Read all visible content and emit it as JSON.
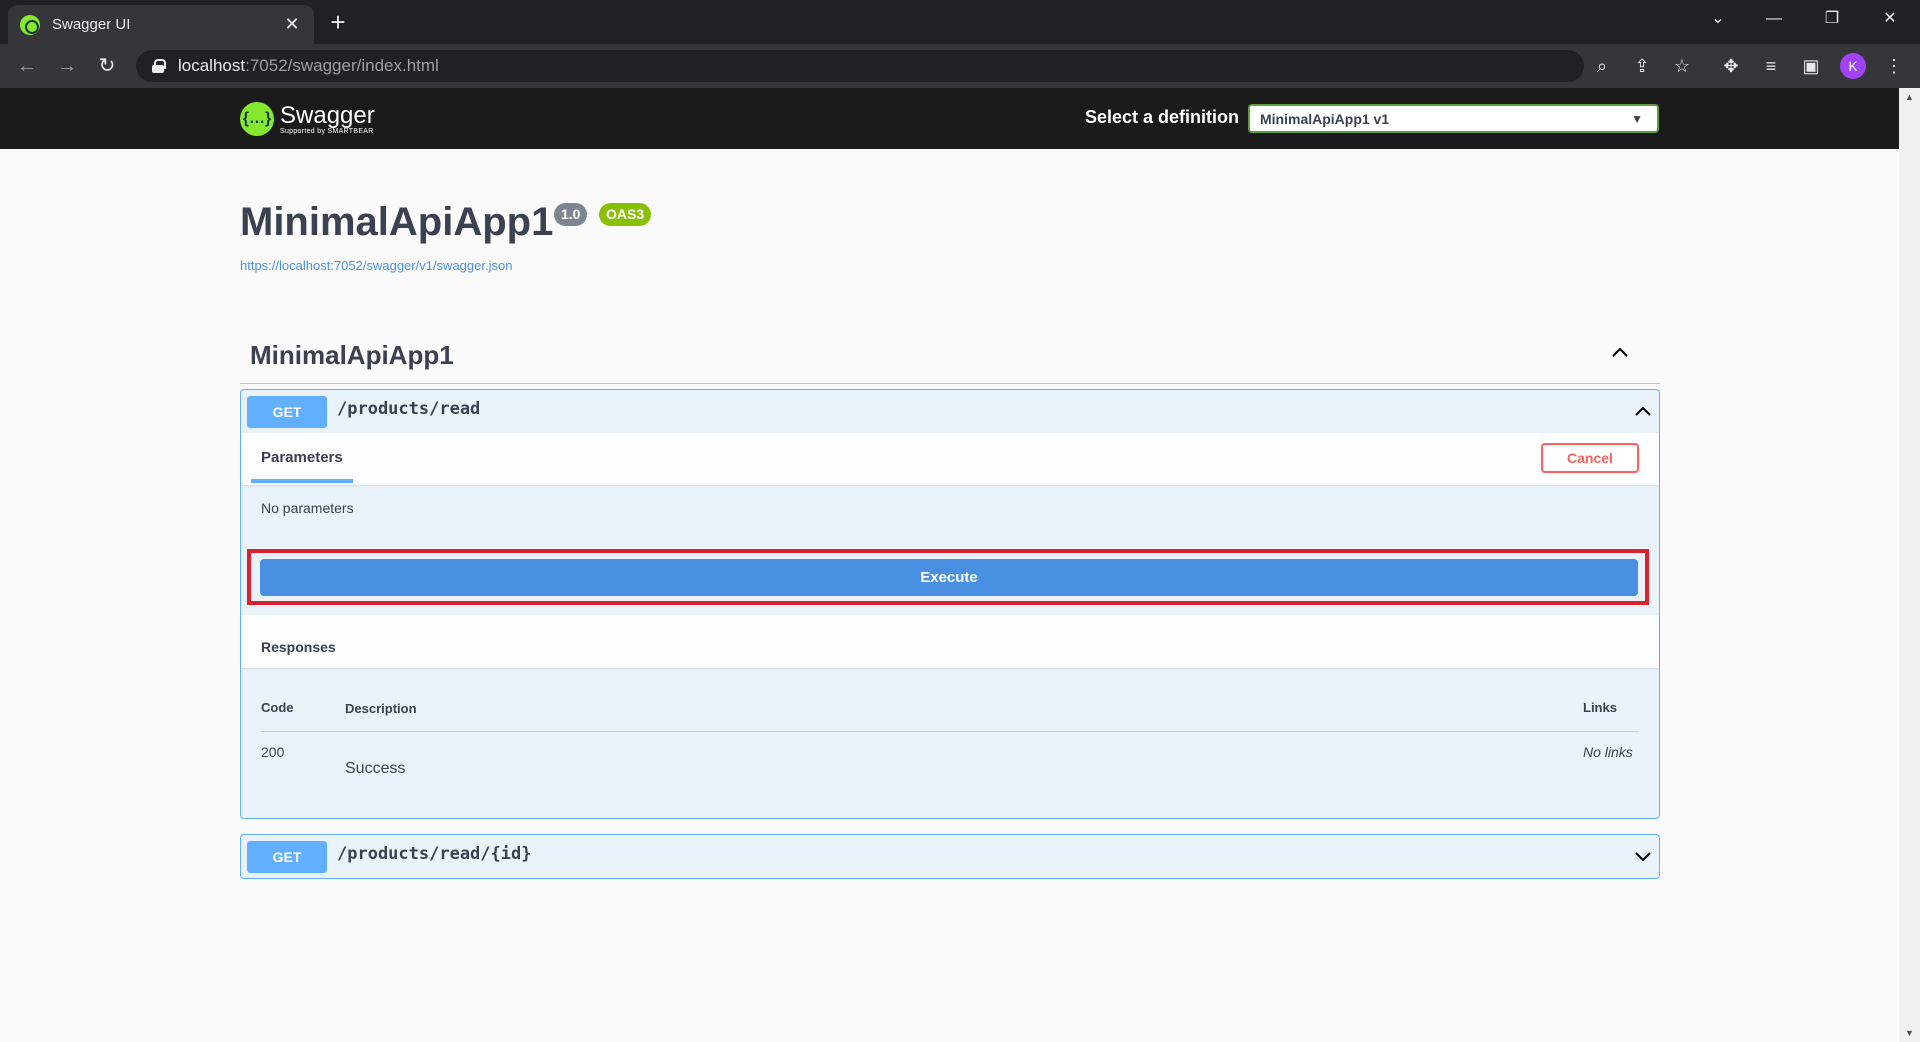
{
  "browser": {
    "tab_title": "Swagger UI",
    "url_host": "localhost",
    "url_path": ":7052/swagger/index.html",
    "profile_initial": "K"
  },
  "swagger": {
    "logo_text": "Swagger",
    "logo_subtext": "Supported by SMARTBEAR",
    "definition_label": "Select a definition",
    "definition_selected": "MinimalApiApp1 v1"
  },
  "info": {
    "title": "MinimalApiApp1",
    "version": "1.0",
    "oas": "OAS3",
    "spec_url": "https://localhost:7052/swagger/v1/swagger.json"
  },
  "tag": {
    "name": "MinimalApiApp1"
  },
  "operations": [
    {
      "method": "GET",
      "path": "/products/read",
      "parameters_tab": "Parameters",
      "cancel_label": "Cancel",
      "no_params": "No parameters",
      "execute_label": "Execute",
      "responses_title": "Responses",
      "columns": {
        "code": "Code",
        "description": "Description",
        "links": "Links"
      },
      "responses": [
        {
          "code": "200",
          "description": "Success",
          "links": "No links"
        }
      ]
    },
    {
      "method": "GET",
      "path": "/products/read/{id}"
    }
  ],
  "colors": {
    "get": "#61affe",
    "execute": "#4990e2",
    "cancel": "#ff6060",
    "highlight": "#d9232e",
    "swagger_green": "#85ea2d"
  }
}
